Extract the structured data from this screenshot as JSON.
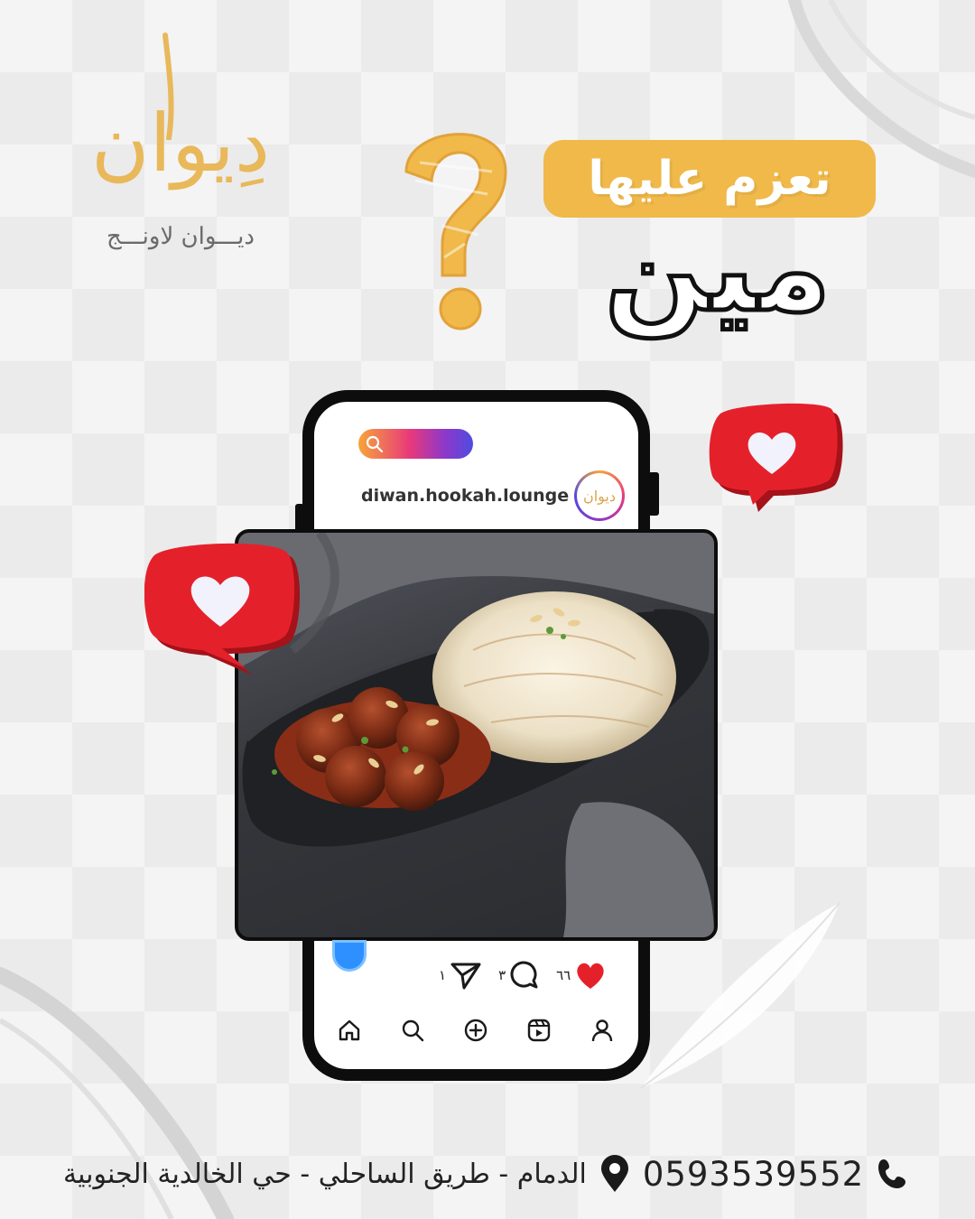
{
  "brand": {
    "logo_text": "دِيوان",
    "tagline": "ديـــوان لاونـــج"
  },
  "headline": {
    "question_line": "تعزم عليها",
    "answer_word": "مين"
  },
  "instagram_post": {
    "username": "diwan.hookah.lounge",
    "avatar_text": "ديوان",
    "likes": "٦٦",
    "comments": "٣",
    "shares": "١"
  },
  "bottom_nav": [
    "home-icon",
    "search-icon",
    "add-post-icon",
    "reels-icon",
    "profile-icon"
  ],
  "contact": {
    "phone": "0593539552",
    "address": "الدمام - طريق الساحلي - حي الخالدية الجنوبية"
  },
  "colors": {
    "accent_gold": "#f0b94a",
    "heart_red": "#e4212b",
    "phone_frame": "#0d0d0d"
  }
}
